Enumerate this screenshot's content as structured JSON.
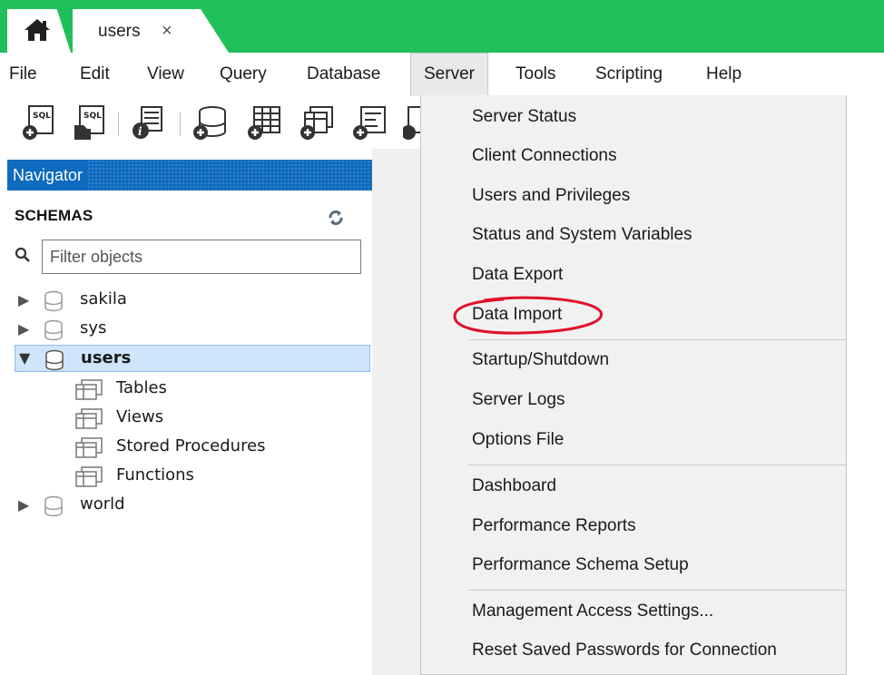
{
  "tabs": {
    "home_icon": "home-icon",
    "active_tab": {
      "label": "users",
      "close_glyph": "×"
    }
  },
  "menubar": {
    "items": [
      "File",
      "Edit",
      "View",
      "Query",
      "Database",
      "Server",
      "Tools",
      "Scripting",
      "Help"
    ],
    "active": "Server"
  },
  "toolbar": {
    "icons": [
      "new-sql-tab-icon",
      "open-sql-script-icon",
      "inspect-object-icon",
      "create-schema-icon",
      "create-table-icon",
      "create-view-icon",
      "create-procedure-icon"
    ]
  },
  "navigator": {
    "title": "Navigator",
    "schemas_label": "SCHEMAS",
    "filter_placeholder": "Filter objects",
    "schemas": [
      {
        "name": "sakila",
        "expanded": false
      },
      {
        "name": "sys",
        "expanded": false
      },
      {
        "name": "users",
        "expanded": true,
        "selected": true,
        "children": [
          "Tables",
          "Views",
          "Stored Procedures",
          "Functions"
        ]
      },
      {
        "name": "world",
        "expanded": false
      }
    ]
  },
  "server_menu": {
    "groups": [
      [
        "Server Status",
        "Client Connections",
        "Users and Privileges",
        "Status and System Variables",
        "Data Export",
        "Data Import"
      ],
      [
        "Startup/Shutdown",
        "Server Logs",
        "Options File"
      ],
      [
        "Dashboard",
        "Performance Reports",
        "Performance Schema Setup"
      ],
      [
        "Management Access Settings...",
        "Reset Saved Passwords for Connection"
      ]
    ],
    "highlighted_item": "Data Import",
    "highlight_color": "#e0102a"
  },
  "colors": {
    "tabstrip": "#1fc05a",
    "navigator_header": "#0e6bbd",
    "selection": "#cfe5fb",
    "menu_bg": "#f1f1f1"
  }
}
